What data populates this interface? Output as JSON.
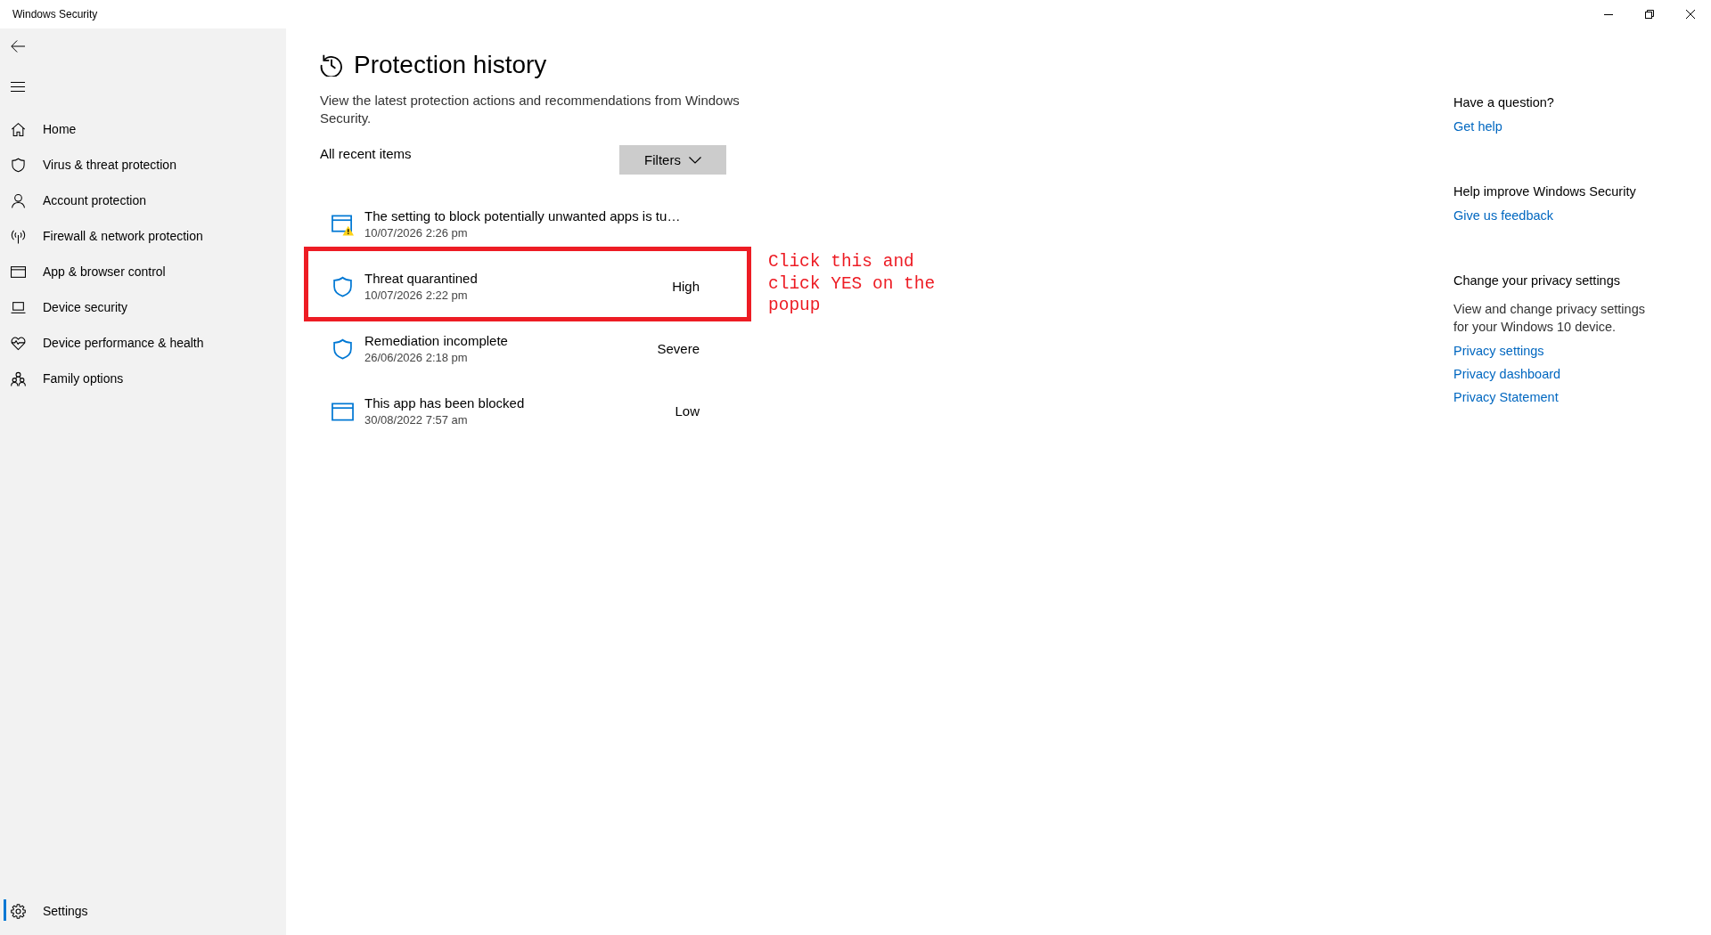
{
  "window": {
    "title": "Windows Security"
  },
  "sidebar": {
    "items": [
      {
        "label": "Home",
        "selected": false
      },
      {
        "label": "Virus & threat protection",
        "selected": false
      },
      {
        "label": "Account protection",
        "selected": false
      },
      {
        "label": "Firewall & network protection",
        "selected": false
      },
      {
        "label": "App & browser control",
        "selected": false
      },
      {
        "label": "Device security",
        "selected": false
      },
      {
        "label": "Device performance & health",
        "selected": false
      },
      {
        "label": "Family options",
        "selected": false
      }
    ],
    "settings": {
      "label": "Settings",
      "selected": true
    }
  },
  "page": {
    "title": "Protection history",
    "description": "View the latest protection actions and recommendations from Windows Security.",
    "list_label": "All recent items",
    "filter_button": "Filters",
    "items": [
      {
        "title": "The setting to block potentially unwanted apps is tu…",
        "date": "10/07/2026 2:26 pm",
        "highlighted": false
      },
      {
        "title": "Threat quarantined",
        "date": "10/07/2026 2:22 pm",
        "severity": "High",
        "highlighted": true
      },
      {
        "title": "Remediation incomplete",
        "date": "26/06/2026 2:18 pm",
        "severity": "Severe",
        "highlighted": false
      },
      {
        "title": "This app has been blocked",
        "date": "30/08/2022 7:57 am",
        "severity": "Low",
        "highlighted": false
      }
    ],
    "annotation": "Click this and click YES on the popup"
  },
  "help": {
    "sections": [
      {
        "heading": "Have a question?",
        "links": [
          "Get help"
        ]
      },
      {
        "heading": "Help improve Windows Security",
        "links": [
          "Give us feedback"
        ]
      },
      {
        "heading": "Change your privacy settings",
        "text": "View and change privacy settings for your Windows 10 device.",
        "links": [
          "Privacy settings",
          "Privacy dashboard",
          "Privacy Statement"
        ]
      }
    ]
  }
}
